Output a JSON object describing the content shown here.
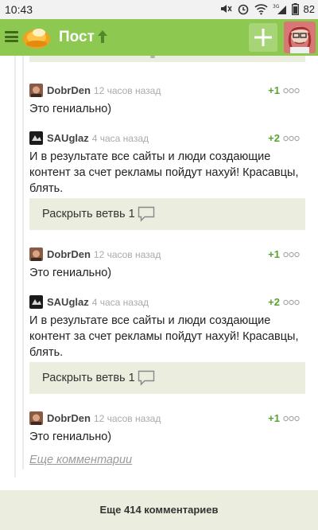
{
  "status_bar": {
    "time": "10:43",
    "network_label": "3G",
    "battery_level": "82",
    "icons": [
      "mute-icon",
      "alarm-icon",
      "wifi-icon",
      "signal-icon",
      "battery-icon"
    ]
  },
  "app_bar": {
    "title": "Пост",
    "icons": [
      "menu-icon",
      "logo-icon",
      "up-arrow-icon",
      "add-icon",
      "avatar"
    ]
  },
  "colors": {
    "app_bar": "#8dc850",
    "rating": "#56a331",
    "branch_background": "#ebeedf"
  },
  "comments": [
    {
      "author": "DobrDen",
      "time": "12 часов назад",
      "rating": "+1",
      "text": "Это гениально)"
    },
    {
      "author": "SAUglaz",
      "time": "4 часа назад",
      "rating": "+2",
      "text": "И в результате все сайты и люди создающие контент за счет рекламы пойдут нахуй! Красавцы, блять."
    },
    {
      "author": "DobrDen",
      "time": "12 часов назад",
      "rating": "+1",
      "text": "Это гениально)"
    },
    {
      "author": "SAUglaz",
      "time": "4 часа назад",
      "rating": "+2",
      "text": "И в результате все сайты и люди создающие контент за счет рекламы пойдут нахуй! Красавцы, блять."
    },
    {
      "author": "DobrDen",
      "time": "12 часов назад",
      "rating": "+1",
      "text": "Это гениально)"
    }
  ],
  "branches": [
    {
      "label": "Раскрыть ветвь 1"
    },
    {
      "label": "Раскрыть ветвь 1"
    }
  ],
  "more_comments_link": "Еще комментарии",
  "footer": {
    "label": "Еще 414 комментариев"
  }
}
